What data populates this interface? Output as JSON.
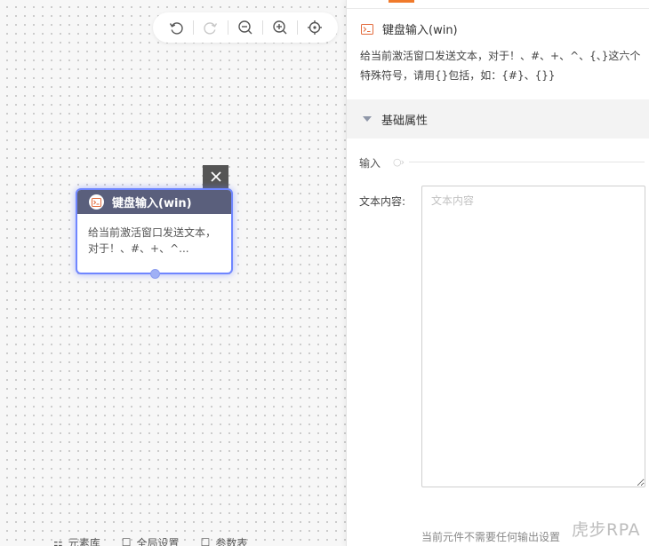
{
  "toolbar": {
    "buttons": [
      {
        "name": "undo",
        "icon": "undo-icon",
        "enabled": true
      },
      {
        "name": "redo",
        "icon": "redo-icon",
        "enabled": false
      },
      {
        "name": "zoom-out",
        "icon": "zoom-out-icon",
        "enabled": true
      },
      {
        "name": "zoom-in",
        "icon": "zoom-in-icon",
        "enabled": true
      },
      {
        "name": "locate",
        "icon": "crosshair-icon",
        "enabled": true
      }
    ]
  },
  "node": {
    "title": "键盘输入(win)",
    "body": "给当前激活窗口发送文本，对于！、#、+、^...",
    "icon": "terminal-icon",
    "header_color": "#5a5f7c",
    "selected_border_color": "#6f86ff"
  },
  "bottom_bar": {
    "items": [
      "元素库",
      "全局设置",
      "参数表"
    ]
  },
  "panel": {
    "title": "键盘输入(win)",
    "title_icon": "terminal-icon",
    "description": "给当前激活窗口发送文本，对于！、#、+、^、{、}这六个特殊符号，请用{}包括，如：{#}、{}}",
    "section_title": "基础属性",
    "input_group_label": "输入",
    "text_field": {
      "label": "文本内容:",
      "placeholder": "文本内容",
      "value": ""
    },
    "no_output_text": "当前元件不需要任何输出设置",
    "accent_color": "#f07a2b"
  },
  "watermark": "虎步RPA"
}
